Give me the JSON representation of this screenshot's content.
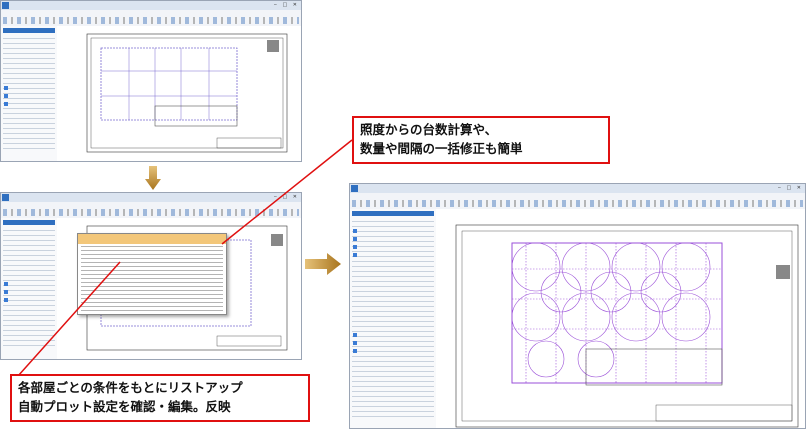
{
  "callouts": {
    "top_right_line1": "照度からの台数計算や、",
    "top_right_line2": "数量や間隔の一括修正も簡単",
    "bottom_left_line1": "各部屋ごとの条件をもとにリストアップ",
    "bottom_left_line2": "自動プロット設定を確認・編集。反映"
  },
  "colors": {
    "callout_border": "#e01010",
    "arrow_fill": "#c9962e",
    "ui_accent": "#2f6fc0",
    "plot_marks": "#9a4fd8"
  },
  "icons": {
    "down_arrow": "down-arrow-icon",
    "right_arrow": "right-arrow-icon"
  }
}
